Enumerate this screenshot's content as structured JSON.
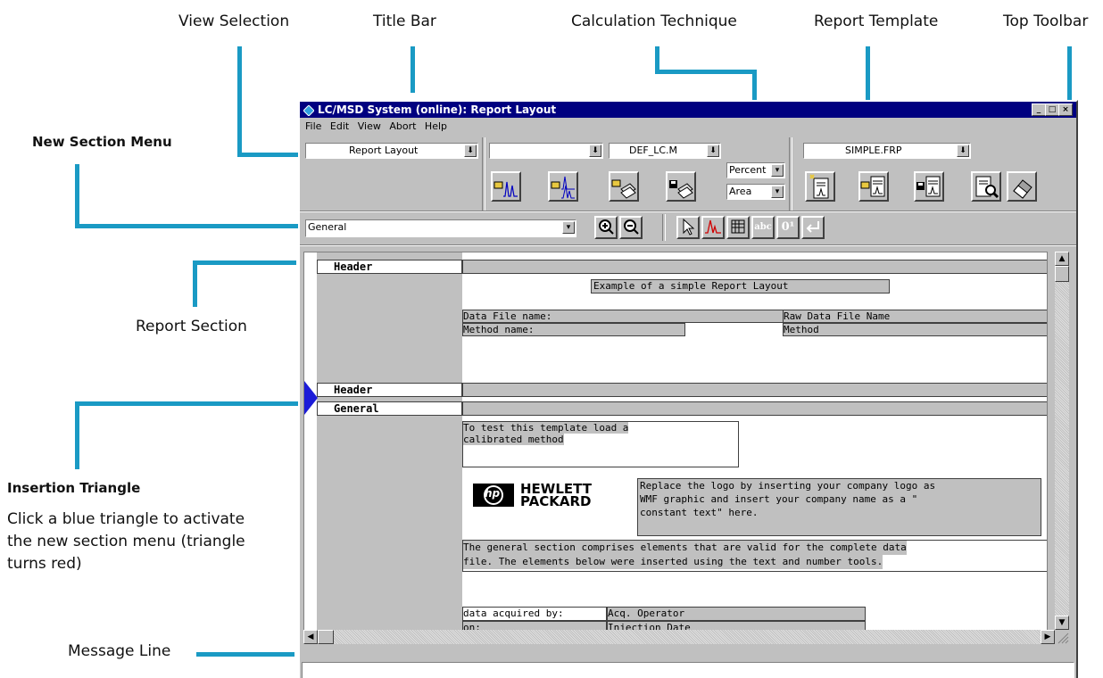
{
  "callouts": {
    "view_selection": "View Selection",
    "title_bar": "Title Bar",
    "calculation_technique": "Calculation Technique",
    "report_template": "Report Template",
    "top_toolbar": "Top Toolbar",
    "new_section_menu": "New Section Menu",
    "report_section": "Report Section",
    "insertion_triangle": "Insertion Triangle",
    "insertion_desc_1": "Click a blue triangle to activate",
    "insertion_desc_2": "the new section menu (triangle",
    "insertion_desc_3": "turns red)",
    "message_line": "Message Line"
  },
  "window": {
    "title": "LC/MSD System (online): Report Layout",
    "menu": [
      "File",
      "Edit",
      "View",
      "Abort",
      "Help"
    ]
  },
  "toolbar": {
    "view_selection": "Report Layout",
    "combo2": "",
    "method": "DEF_LC.M",
    "calc_percent": "Percent",
    "calc_area": "Area",
    "template": "SIMPLE.FRP",
    "section_select": "General",
    "tool_text": "abc",
    "tool_number": "0¹"
  },
  "report": {
    "header1": "Header",
    "example_title": "Example of a simple Report Layout",
    "data_file_label": "Data File name:",
    "raw_data_label": "Raw Data File Name",
    "method_label": "Method name:",
    "method_value": "Method",
    "header2": "Header",
    "general": "General",
    "test_line1": "To test this template load a",
    "test_line2": "calibrated method",
    "logo_line1": "HEWLETT",
    "logo_line2": "PACKARD",
    "logo_mark": "hp",
    "replace_line1": "Replace the logo by inserting your company logo as",
    "replace_line2": "WMF graphic and insert your company name as a \"",
    "replace_line3": "constant text\"  here.",
    "general_desc1": "The general section comprises elements that are valid for the complete data",
    "general_desc2": "file. The elements below were inserted using the text and number tools.",
    "acq_label": "data acquired by:",
    "acq_value": "Acq. Operator",
    "on_label": "on:",
    "on_value": "Injection Date"
  },
  "colors": {
    "callout_line": "#1a9ac4",
    "title_bg": "#000080",
    "triangle": "#1c1cd8"
  }
}
